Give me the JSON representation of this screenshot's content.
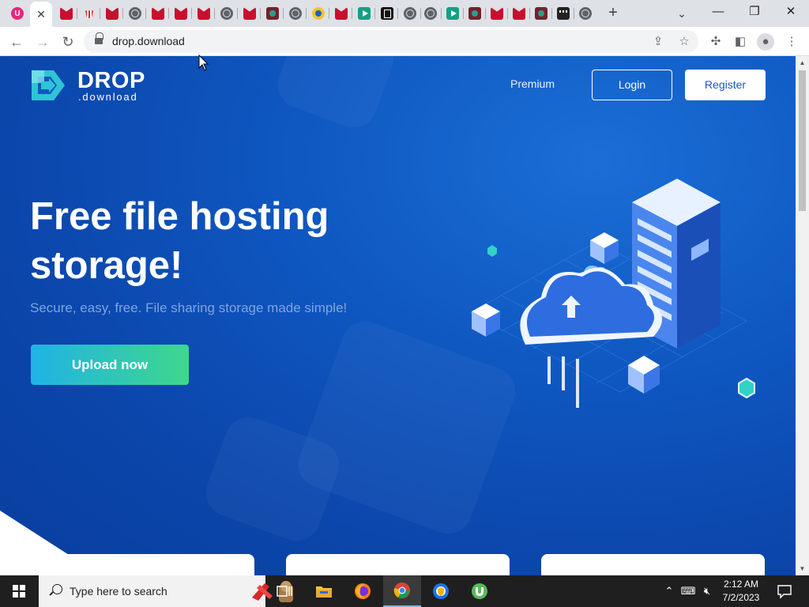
{
  "browser": {
    "tabs": [
      {
        "icon": "ublock-icon",
        "active": false
      },
      {
        "icon": "close-icon",
        "active": true
      },
      {
        "icon": "mcafee-icon"
      },
      {
        "icon": "popcorn-icon"
      },
      {
        "icon": "mcafee-icon"
      },
      {
        "icon": "globe-icon"
      },
      {
        "icon": "mcafee-icon"
      },
      {
        "icon": "mcafee-icon"
      },
      {
        "icon": "mcafee-icon"
      },
      {
        "icon": "globe-icon"
      },
      {
        "icon": "mcafee-icon"
      },
      {
        "icon": "reel-icon"
      },
      {
        "icon": "globe-icon"
      },
      {
        "icon": "eye-icon"
      },
      {
        "icon": "mcafee-icon"
      },
      {
        "icon": "play-icon"
      },
      {
        "icon": "dark-box-icon"
      },
      {
        "icon": "globe-icon"
      },
      {
        "icon": "globe-icon"
      },
      {
        "icon": "play-icon"
      },
      {
        "icon": "reel-icon"
      },
      {
        "icon": "mcafee-icon"
      },
      {
        "icon": "mcafee-icon"
      },
      {
        "icon": "reel-icon"
      },
      {
        "icon": "clapper-icon"
      },
      {
        "icon": "globe-icon"
      }
    ],
    "new_tab_label": "+",
    "url": "drop.download"
  },
  "site": {
    "logo_word": "DROP",
    "logo_sub": ".download",
    "nav": {
      "premium": "Premium",
      "login": "Login",
      "register": "Register"
    },
    "hero": {
      "title": "Free file hosting storage!",
      "subtitle": "Secure, easy, free. File sharing storage made simple!",
      "cta": "Upload now"
    },
    "colors": {
      "background": "#0f58c2",
      "cta_start": "#1fb3e6",
      "cta_end": "#3fd78c",
      "logo_accent": "#2ec4d6"
    }
  },
  "taskbar": {
    "search_placeholder": "Type here to search",
    "time": "2:12 AM",
    "date": "7/2/2023",
    "apps": [
      "task-view-icon",
      "file-explorer-icon",
      "firefox-icon",
      "chrome-icon",
      "brave-like-icon",
      "utorrent-icon"
    ]
  }
}
